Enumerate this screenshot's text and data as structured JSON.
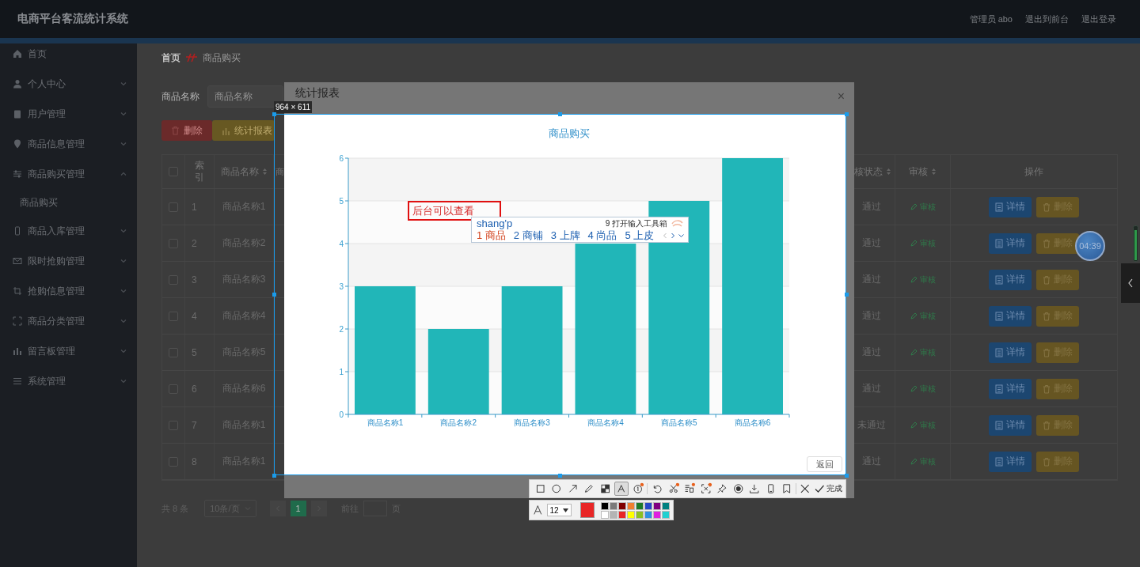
{
  "header": {
    "title": "电商平台客流统计系统",
    "links": [
      "管理员 abo",
      "退出到前台",
      "退出登录"
    ]
  },
  "sidebar": {
    "items": [
      {
        "label": "首页",
        "kind": "link"
      },
      {
        "label": "个人中心",
        "kind": "menu",
        "expanded": false
      },
      {
        "label": "用户管理",
        "kind": "menu",
        "expanded": false
      },
      {
        "label": "商品信息管理",
        "kind": "menu",
        "expanded": false
      },
      {
        "label": "商品购买管理",
        "kind": "menu",
        "expanded": true,
        "children": [
          {
            "label": "商品购买"
          }
        ]
      },
      {
        "label": "商品入库管理",
        "kind": "menu",
        "expanded": false
      },
      {
        "label": "限时抢购管理",
        "kind": "menu",
        "expanded": false
      },
      {
        "label": "抢购信息管理",
        "kind": "menu",
        "expanded": false
      },
      {
        "label": "商品分类管理",
        "kind": "menu",
        "expanded": false
      },
      {
        "label": "留言板管理",
        "kind": "menu",
        "expanded": false
      },
      {
        "label": "系统管理",
        "kind": "menu",
        "expanded": false
      }
    ]
  },
  "breadcrumb": [
    "首页",
    "商品购买"
  ],
  "search": {
    "label": "商品名称",
    "placeholder": "商品名称"
  },
  "actions": [
    "删除",
    "统计报表"
  ],
  "table": {
    "header_checked": false,
    "columns": [
      {
        "label": "索引",
        "sortable": false
      },
      {
        "label": "商品名称",
        "sortable": true
      },
      {
        "label": "商",
        "sortable": false
      },
      {
        "label": "核状态",
        "sortable": true
      },
      {
        "label": "审核",
        "sortable": true
      },
      {
        "label": "操作",
        "sortable": false
      }
    ],
    "rows": [
      {
        "checked": false,
        "index": "1",
        "name": "商品名称1",
        "status": "通过",
        "review": "审核",
        "buttons": [
          "详情",
          "删除"
        ]
      },
      {
        "checked": false,
        "index": "2",
        "name": "商品名称2",
        "status": "通过",
        "review": "审核",
        "buttons": [
          "详情",
          "删除"
        ]
      },
      {
        "checked": false,
        "index": "3",
        "name": "商品名称3",
        "status": "通过",
        "review": "审核",
        "buttons": [
          "详情",
          "删除"
        ]
      },
      {
        "checked": false,
        "index": "4",
        "name": "商品名称4",
        "status": "通过",
        "review": "审核",
        "buttons": [
          "详情",
          "删除"
        ]
      },
      {
        "checked": false,
        "index": "5",
        "name": "商品名称5",
        "status": "通过",
        "review": "审核",
        "buttons": [
          "详情",
          "删除"
        ]
      },
      {
        "checked": false,
        "index": "6",
        "name": "商品名称6",
        "status": "通过",
        "review": "审核",
        "buttons": [
          "详情",
          "删除"
        ]
      },
      {
        "checked": false,
        "index": "7",
        "name": "商品名称1",
        "status": "未通过",
        "review": "审核",
        "buttons": [
          "详情",
          "删除"
        ]
      },
      {
        "checked": false,
        "index": "8",
        "name": "商品名称1",
        "status": "通过",
        "review": "审核",
        "buttons": [
          "详情",
          "删除"
        ]
      }
    ]
  },
  "pagination": {
    "total": "共 8 条",
    "page_size": "10条/页",
    "pages": [
      {
        "label": "1",
        "selected": true
      }
    ],
    "goto_label": "前往",
    "goto_suffix": "页"
  },
  "dialog": {
    "title": "统计报表",
    "close": "×",
    "back_button": "返回",
    "chart_data": {
      "type": "bar",
      "title": "商品购买",
      "grid": true,
      "categories": [
        "商品名称1",
        "商品名称2",
        "商品名称3",
        "商品名称4",
        "商品名称5",
        "商品名称6"
      ],
      "values": [
        3,
        2,
        3,
        4,
        5,
        6
      ],
      "ylim": [
        0,
        6
      ],
      "yticks": [
        0,
        1,
        2,
        3,
        4,
        5,
        6
      ]
    }
  },
  "capture": {
    "size_label": "964 × 611",
    "annotation": "后台可以查看",
    "ime": {
      "input": "shang'p",
      "toolbox": "9 打开输入工具箱",
      "candidates": [
        {
          "number": "1",
          "text": "商品",
          "selected": true
        },
        {
          "number": "2",
          "text": "商铺",
          "selected": false
        },
        {
          "number": "3",
          "text": "上牌",
          "selected": false
        },
        {
          "number": "4",
          "text": "尚品",
          "selected": false
        },
        {
          "number": "5",
          "text": "上皮",
          "selected": false
        }
      ]
    },
    "tools": [
      {
        "selected": false,
        "badge": false
      },
      {
        "selected": false,
        "badge": false
      },
      {
        "selected": false,
        "badge": false
      },
      {
        "selected": false,
        "badge": false
      },
      {
        "selected": false,
        "badge": false
      },
      {
        "selected": true,
        "badge": false
      },
      {
        "selected": false,
        "badge": true
      },
      {
        "selected": false,
        "badge": false
      },
      {
        "selected": false,
        "badge": true
      },
      {
        "selected": false,
        "badge": true
      },
      {
        "selected": false,
        "badge": true
      },
      {
        "selected": false,
        "badge": false
      },
      {
        "selected": false,
        "badge": false
      },
      {
        "selected": false,
        "badge": false
      },
      {
        "selected": false,
        "badge": false
      },
      {
        "selected": false,
        "badge": false
      }
    ],
    "done": "完成",
    "text_style": {
      "size": "12",
      "color": "#e82626",
      "palette": [
        {
          "color": "#000000"
        },
        {
          "color": "#7a7a7a"
        },
        {
          "color": "#800000"
        },
        {
          "color": "#f08030"
        },
        {
          "color": "#1e7a28"
        },
        {
          "color": "#2848c8"
        },
        {
          "color": "#800080"
        },
        {
          "color": "#008080"
        },
        {
          "color": "#ffffff"
        },
        {
          "color": "#b4b4b4"
        },
        {
          "color": "#e82626"
        },
        {
          "color": "#ffff00"
        },
        {
          "color": "#8cc020"
        },
        {
          "color": "#3090e0"
        },
        {
          "color": "#e020e0"
        },
        {
          "color": "#20d0d0"
        }
      ]
    }
  },
  "timer": {
    "label": "04:39"
  }
}
